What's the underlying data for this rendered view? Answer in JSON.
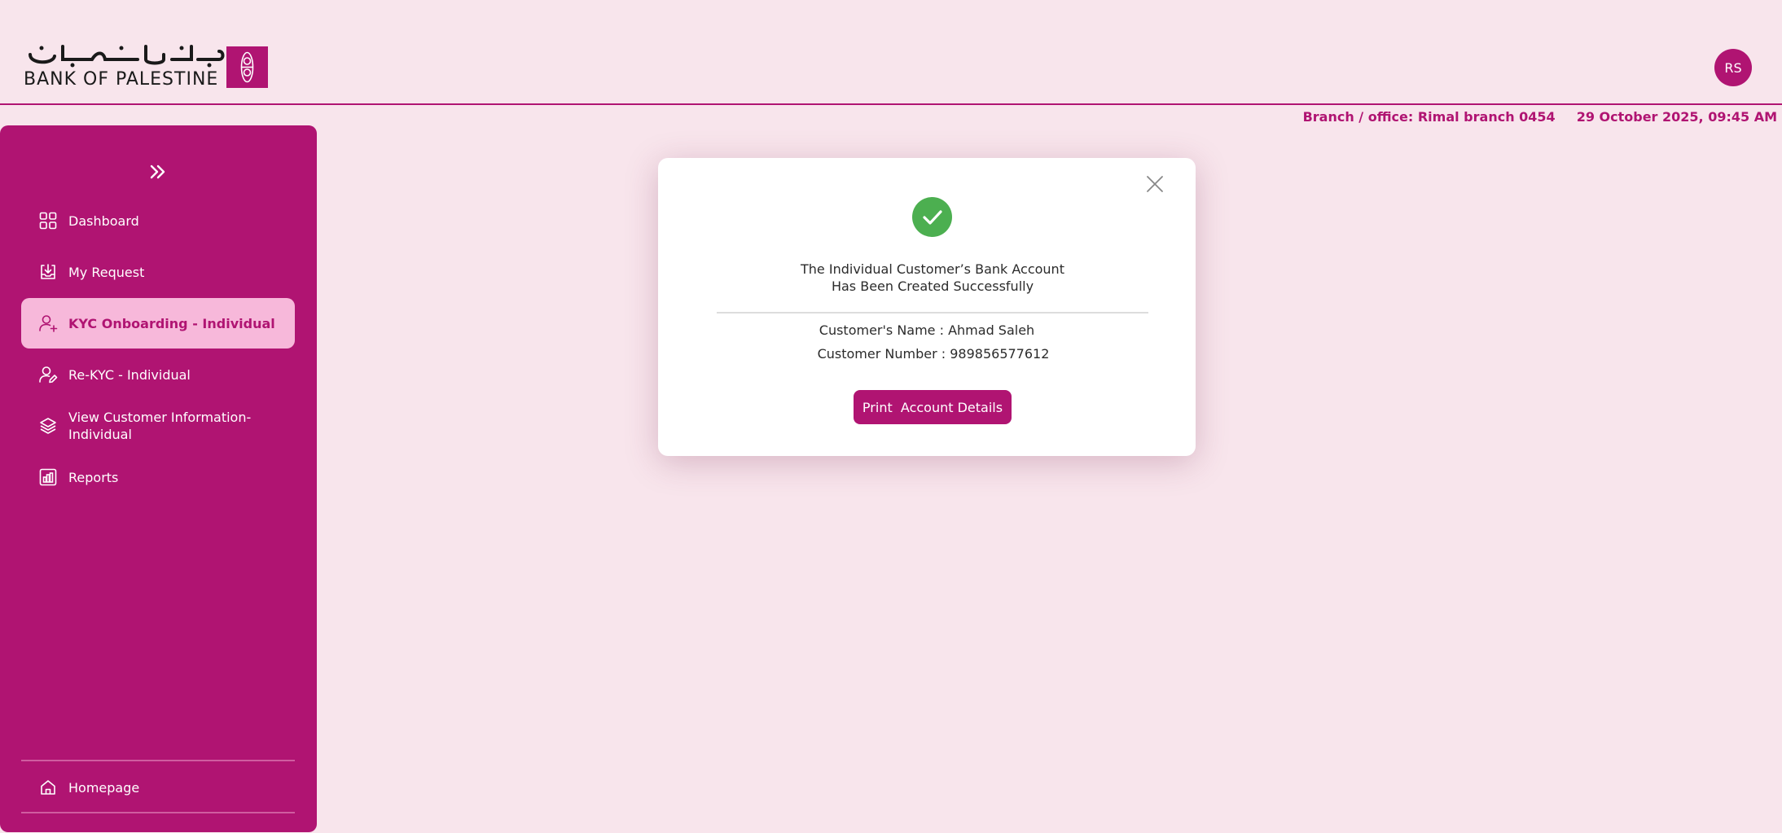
{
  "header": {
    "logo_latin": "BANK OF PALESTINE",
    "logo_arabic": "بنـك فلســطين",
    "avatar_initials": "RS",
    "branch": "Branch / office: Rimal branch 0454",
    "datetime": "29 October 2025, 09:45 AM"
  },
  "sidebar": {
    "items": [
      {
        "label": "Dashboard",
        "icon": "grid-icon"
      },
      {
        "label": "My Request",
        "icon": "download-tray-icon"
      },
      {
        "label": "KYC Onboarding - Individual",
        "icon": "user-plus-icon",
        "active": true
      },
      {
        "label": "Re-KYC - Individual",
        "icon": "user-edit-icon"
      },
      {
        "label": "View Customer Information- Individual",
        "icon": "layers-icon"
      },
      {
        "label": "Reports",
        "icon": "bar-chart-icon"
      }
    ],
    "footer_item": {
      "label": "Homepage",
      "icon": "home-icon"
    }
  },
  "modal": {
    "title_line1": "The Individual Customer’s Bank Account",
    "title_line2": "Has Been Created Successfully",
    "customer_name": "Customer's Name : Ahmad Saleh",
    "customer_number": "Customer Number : 989856577612",
    "print_button": "Print  Account Details"
  },
  "colors": {
    "brand": "#b01472",
    "background": "#f8e5ec",
    "active_item_bg": "#f7b8da",
    "success": "#4caf50"
  }
}
